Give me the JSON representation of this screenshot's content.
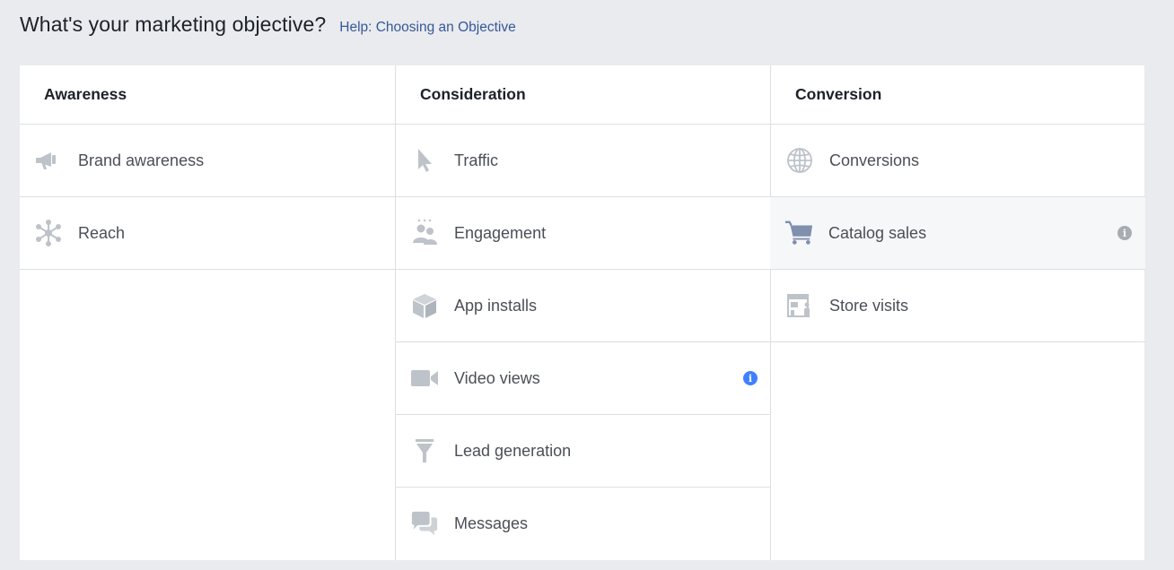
{
  "header": {
    "title": "What's your marketing objective?",
    "help_link": "Help: Choosing an Objective"
  },
  "columns": [
    {
      "title": "Awareness",
      "items": [
        {
          "label": "Brand awareness",
          "icon": "megaphone-icon"
        },
        {
          "label": "Reach",
          "icon": "reach-icon"
        }
      ]
    },
    {
      "title": "Consideration",
      "items": [
        {
          "label": "Traffic",
          "icon": "cursor-icon"
        },
        {
          "label": "Engagement",
          "icon": "people-icon"
        },
        {
          "label": "App installs",
          "icon": "box-icon"
        },
        {
          "label": "Video views",
          "icon": "video-camera-icon",
          "info": "info-icon"
        },
        {
          "label": "Lead generation",
          "icon": "funnel-icon"
        },
        {
          "label": "Messages",
          "icon": "chat-bubbles-icon"
        }
      ]
    },
    {
      "title": "Conversion",
      "items": [
        {
          "label": "Conversions",
          "icon": "globe-icon"
        },
        {
          "label": "Catalog sales",
          "icon": "shopping-cart-icon",
          "info": "info-icon",
          "selected": true
        },
        {
          "label": "Store visits",
          "icon": "store-icon"
        }
      ]
    }
  ],
  "colors": {
    "background": "#e9ebee",
    "panel": "#ffffff",
    "link": "#365899",
    "icon": "#bec3c9",
    "icon_selected": "#7f8fad",
    "info_blue": "#4080ff",
    "info_grey": "#a8acb3"
  },
  "info_glyph": "i"
}
